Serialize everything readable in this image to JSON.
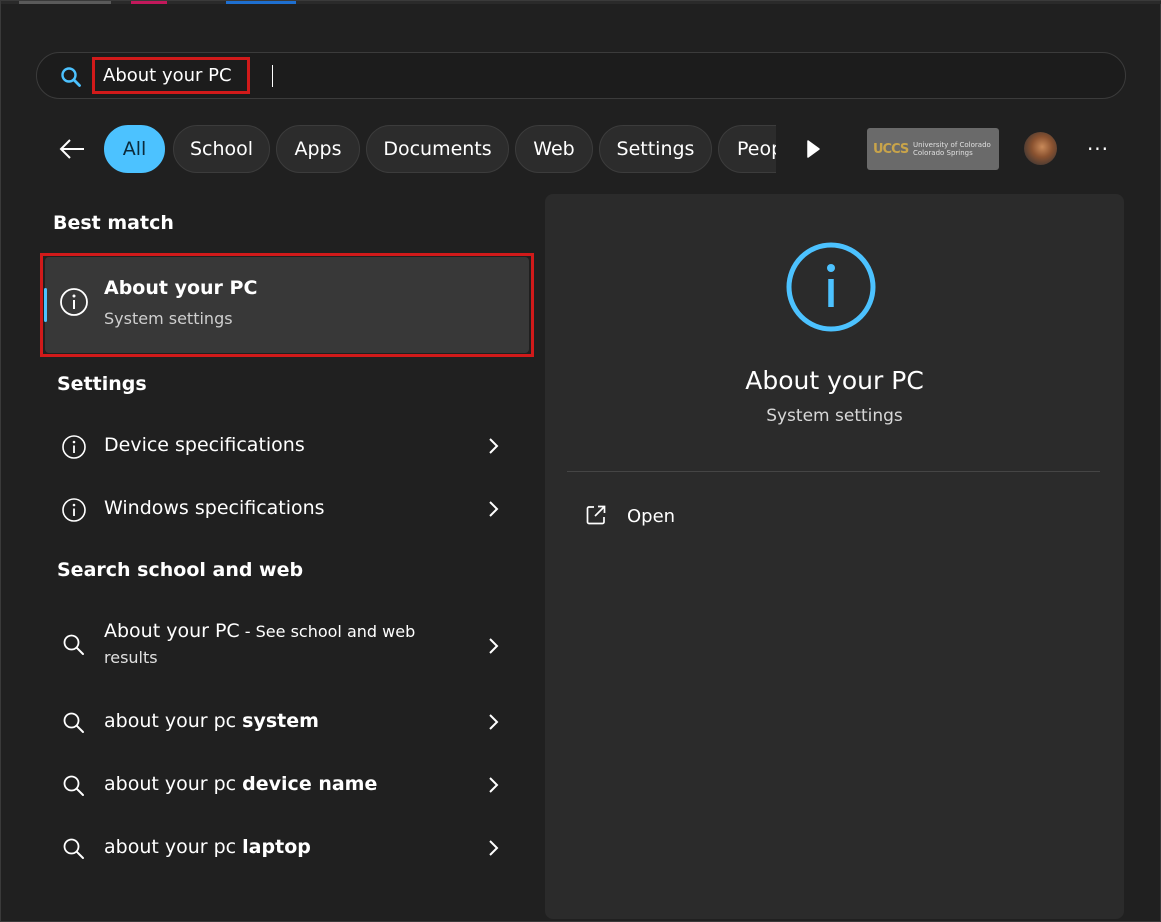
{
  "search": {
    "value": "About your PC"
  },
  "filters": {
    "chips": [
      "All",
      "School",
      "Apps",
      "Documents",
      "Web",
      "Settings",
      "Peop"
    ],
    "active": "All"
  },
  "org_logo": {
    "mark": "UCCS",
    "line1": "University of Colorado",
    "line2": "Colorado Springs"
  },
  "more_label": "···",
  "best_match": {
    "heading": "Best match",
    "title": "About your PC",
    "subtitle": "System settings"
  },
  "settings": {
    "heading": "Settings",
    "items": [
      "Device specifications",
      "Windows specifications"
    ]
  },
  "web": {
    "heading": "Search school and web",
    "first": {
      "title": "About your PC",
      "suffix": " - See school and web",
      "suffix_line2": "results"
    },
    "items": [
      {
        "prefix": "about your pc ",
        "bold": "system"
      },
      {
        "prefix": "about your pc ",
        "bold": "device name"
      },
      {
        "prefix": "about your pc ",
        "bold": "laptop"
      }
    ]
  },
  "detail": {
    "title": "About your PC",
    "subtitle": "System settings",
    "action": "Open"
  },
  "colors": {
    "accent": "#4cc2ff",
    "highlight_box": "#d11a1a",
    "background": "#202020",
    "panel": "#2b2b2b"
  }
}
